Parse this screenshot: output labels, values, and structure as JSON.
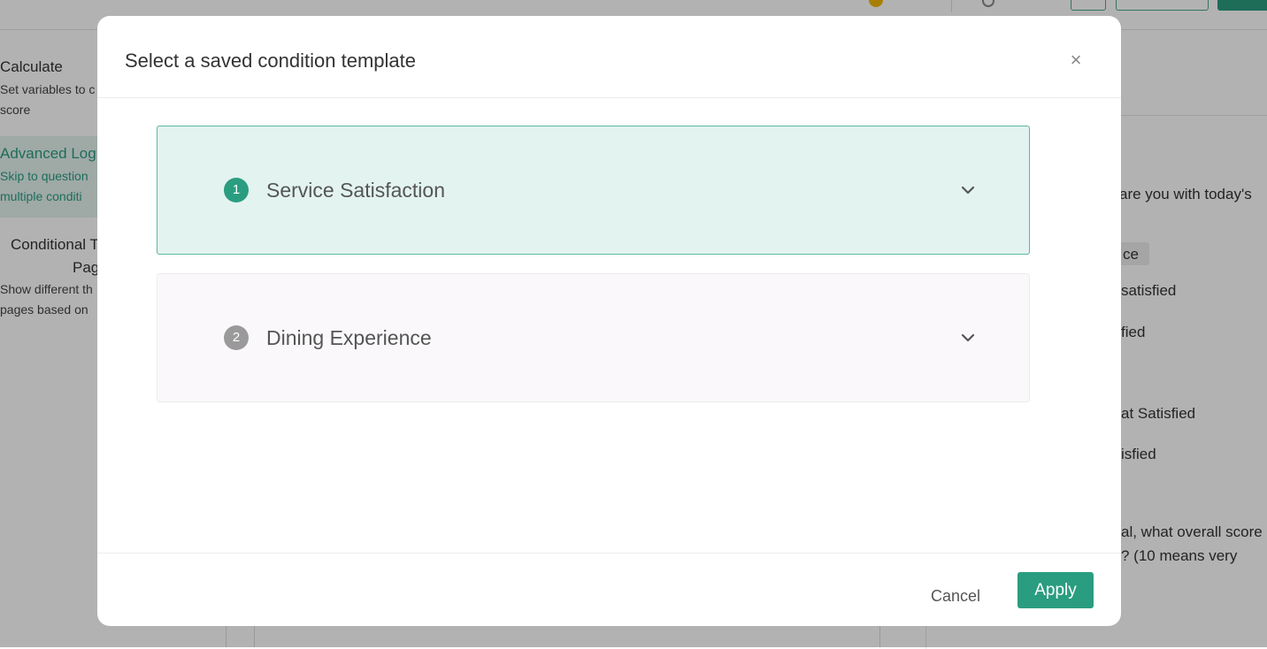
{
  "background": {
    "left_panel": {
      "calculate": {
        "title": "Calculate",
        "desc_line1": "Set variables to c",
        "desc_line2": "score"
      },
      "advanced_logic": {
        "title": "Advanced Log",
        "desc_line1": "Skip to question",
        "desc_line2": "multiple conditi"
      },
      "conditional_page": {
        "title": "Conditional T",
        "title_line2": "Pag",
        "desc_line1": "Show different th",
        "desc_line2": "pages based on"
      }
    },
    "right_panel": {
      "question_fragment": "are you with today's",
      "chip_fragment": "ce",
      "option1": "satisfied",
      "option2": "fied",
      "option3": "at Satisfied",
      "option4": "isfied",
      "question2_line1": "al, what overall score",
      "question2_line2": "? (10 means very"
    }
  },
  "modal": {
    "title": "Select a saved condition template",
    "close_label": "×",
    "templates": [
      {
        "number": "1",
        "name": "Service Satisfaction",
        "selected": true
      },
      {
        "number": "2",
        "name": "Dining Experience",
        "selected": false
      }
    ],
    "cancel_label": "Cancel",
    "apply_label": "Apply"
  },
  "colors": {
    "accent": "#2a9d80",
    "selected_bg": "#e3f3f0",
    "selected_border": "#5cb8a0"
  }
}
